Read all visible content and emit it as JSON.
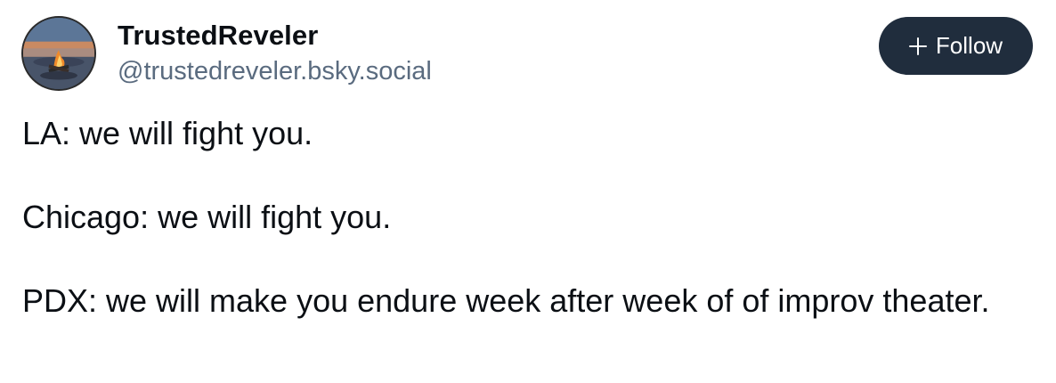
{
  "author": {
    "display_name": "TrustedReveler",
    "handle": "@trustedreveler.bsky.social",
    "avatar_icon": "bonfire-avatar"
  },
  "follow_button": {
    "label": "Follow",
    "icon": "plus-icon",
    "background": "#202d3d",
    "text_color": "#ffffff"
  },
  "post": {
    "paragraphs": [
      "LA: we will fight you.",
      "Chicago: we will fight you.",
      "PDX: we will make you endure week after week of of improv theater."
    ]
  },
  "colors": {
    "text": "#0b0f14",
    "handle": "#5a6b7f"
  }
}
